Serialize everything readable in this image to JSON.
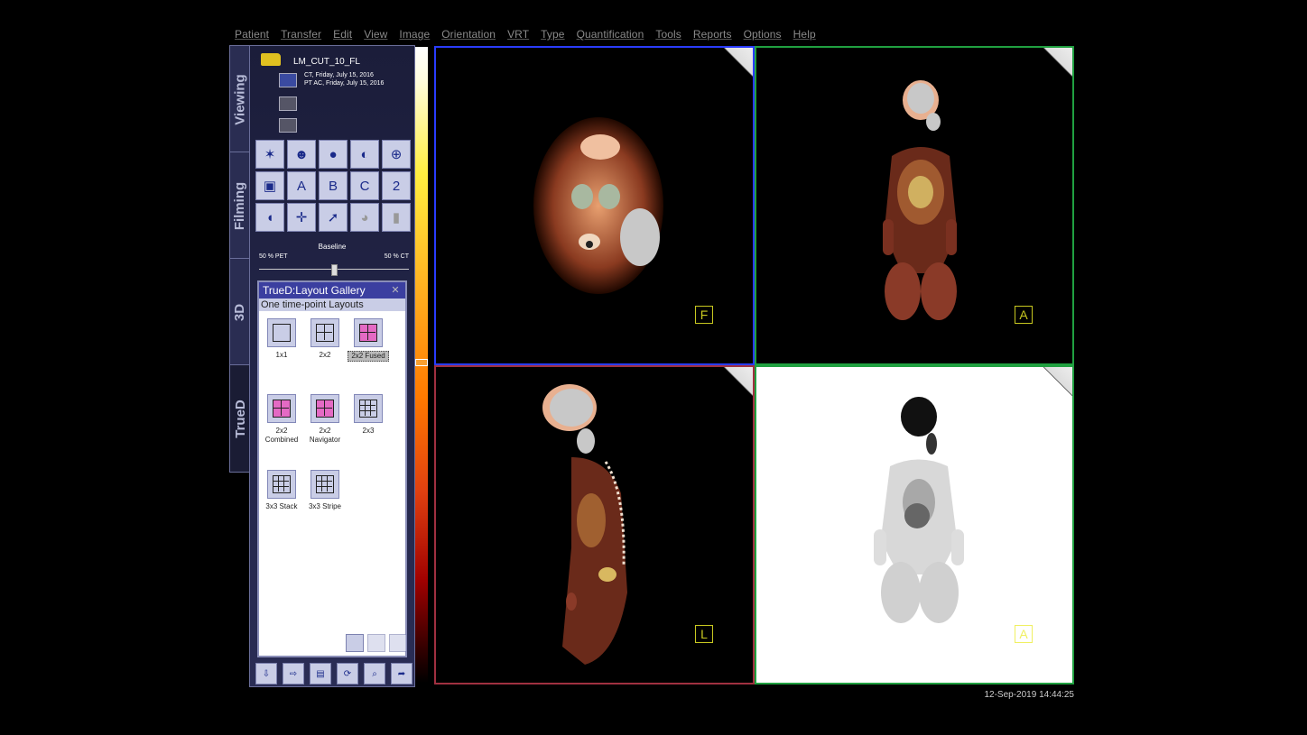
{
  "menu": [
    "Patient",
    "Transfer",
    "Edit",
    "View",
    "Image",
    "Orientation",
    "VRT",
    "Type",
    "Quantification",
    "Tools",
    "Reports",
    "Options",
    "Help"
  ],
  "tabs": [
    "Viewing",
    "Filming",
    "3D",
    "TrueD"
  ],
  "active_tab": "TrueD",
  "patient": {
    "name": "LM_CUT_10_FL",
    "series": [
      "CT, Friday, July 15, 2016",
      "PT AC, Friday, July 15, 2016"
    ]
  },
  "fusion": {
    "baseline_label": "Baseline",
    "pet_label": "50 % PET",
    "ct_label": "50 % CT",
    "mix_fraction": 0.5
  },
  "tool_icons": [
    "crosshair-star-icon",
    "head-pointer-icon",
    "head-blue-icon",
    "head-side-icon",
    "globe-icon",
    "id-card-icon",
    "sun-a-icon",
    "sun-b-icon",
    "sun-c-icon",
    "sun-2-icon",
    "face-profile-icon",
    "cross-target-icon",
    "arrow-cursor-icon",
    "face-gray-icon",
    "torso-gray-icon"
  ],
  "tool_labels": [
    "",
    "",
    "",
    "",
    "",
    "",
    "A",
    "B",
    "C",
    "2",
    "",
    "",
    "",
    "",
    ""
  ],
  "gallery": {
    "title": "TrueD:Layout Gallery",
    "subtitle": "One time-point Layouts",
    "layouts": [
      "1x1",
      "2x2",
      "2x2 Fused",
      "2x2 Combined",
      "2x2 Navigator",
      "2x3",
      "3x3 Stack",
      "3x3 Stripe"
    ],
    "selected": "2x2 Fused"
  },
  "viewports": [
    {
      "orientation": "F",
      "border_color": "#2a3cff"
    },
    {
      "orientation": "A",
      "border_color": "#20a040"
    },
    {
      "orientation": "L",
      "border_color": "#a03040"
    },
    {
      "orientation": "A",
      "border_color": "#20a040"
    }
  ],
  "datetime": "12-Sep-2019 14:44:25"
}
